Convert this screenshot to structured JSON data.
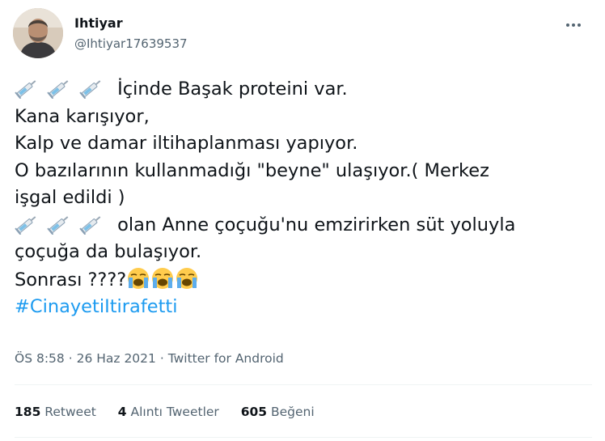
{
  "author": {
    "name": "Ihtiyar",
    "handle": "@Ihtiyar17639537"
  },
  "tweet": {
    "lines": [
      "İçinde Başak proteini var.",
      "Kana karışıyor,",
      "Kalp ve damar iltihaplanması yapıyor.",
      "O bazılarının kullanmadığı \"beyne\" ulaşıyor.( Merkez",
      "işgal edildi )",
      "olan Anne çoçuğu'nu emzirirken süt yoluyla",
      "çoçuğa da bulaşıyor.",
      "Sonrası ????",
      "#CinayetiItirafetti"
    ],
    "icons": {
      "syringe": "syringe-emoji",
      "crying": "loudly-crying-face-emoji"
    }
  },
  "meta": {
    "time": "ÖS 8:58",
    "date": "26 Haz 2021",
    "source": "Twitter for Android"
  },
  "stats": {
    "retweets_count": "185",
    "retweets_label": "Retweet",
    "quotes_count": "4",
    "quotes_label": "Alıntı Tweetler",
    "likes_count": "605",
    "likes_label": "Beğeni"
  },
  "colors": {
    "link": "#1d9bf0",
    "muted": "#536471",
    "text": "#0f1419",
    "divider": "#eff3f4"
  }
}
